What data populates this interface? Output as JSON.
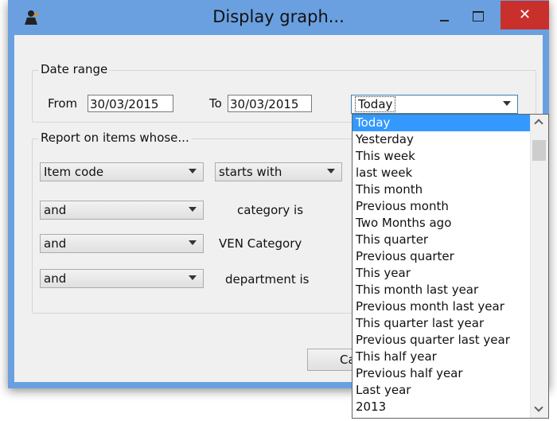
{
  "window": {
    "title": "Display graph...",
    "icon": "app-person-icon",
    "controls": {
      "minimize": "minimize-icon",
      "maximize": "maximize-icon",
      "close": "✕"
    },
    "close_color": "#c9302c",
    "frame_color": "#6aa0e0"
  },
  "date_range": {
    "group_label": "Date range",
    "from_label": "From",
    "from_value": "30/03/2015",
    "to_label": "To",
    "to_value": "30/03/2015",
    "preset_value": "Today"
  },
  "report": {
    "group_label": "Report on items whose...",
    "row1": {
      "field": "Item code",
      "operator": "starts with"
    },
    "row2": {
      "conj": "and",
      "label": "category is"
    },
    "row3": {
      "conj": "and",
      "label": "VEN Category"
    },
    "row4": {
      "conj": "and",
      "label": "department is"
    }
  },
  "buttons": {
    "cancel_partial": "Ca"
  },
  "dropdown": {
    "selected_index": 0,
    "highlight_color": "#3399ff",
    "options": [
      "Today",
      "Yesterday",
      "This week",
      "last week",
      "This month",
      "Previous month",
      "Two Months ago",
      "This quarter",
      "Previous quarter",
      "This year",
      "This month last year",
      "Previous month last year",
      "This quarter last year",
      "Previous quarter last year",
      "This half year",
      "Previous half year",
      "Last year",
      "2013"
    ]
  }
}
